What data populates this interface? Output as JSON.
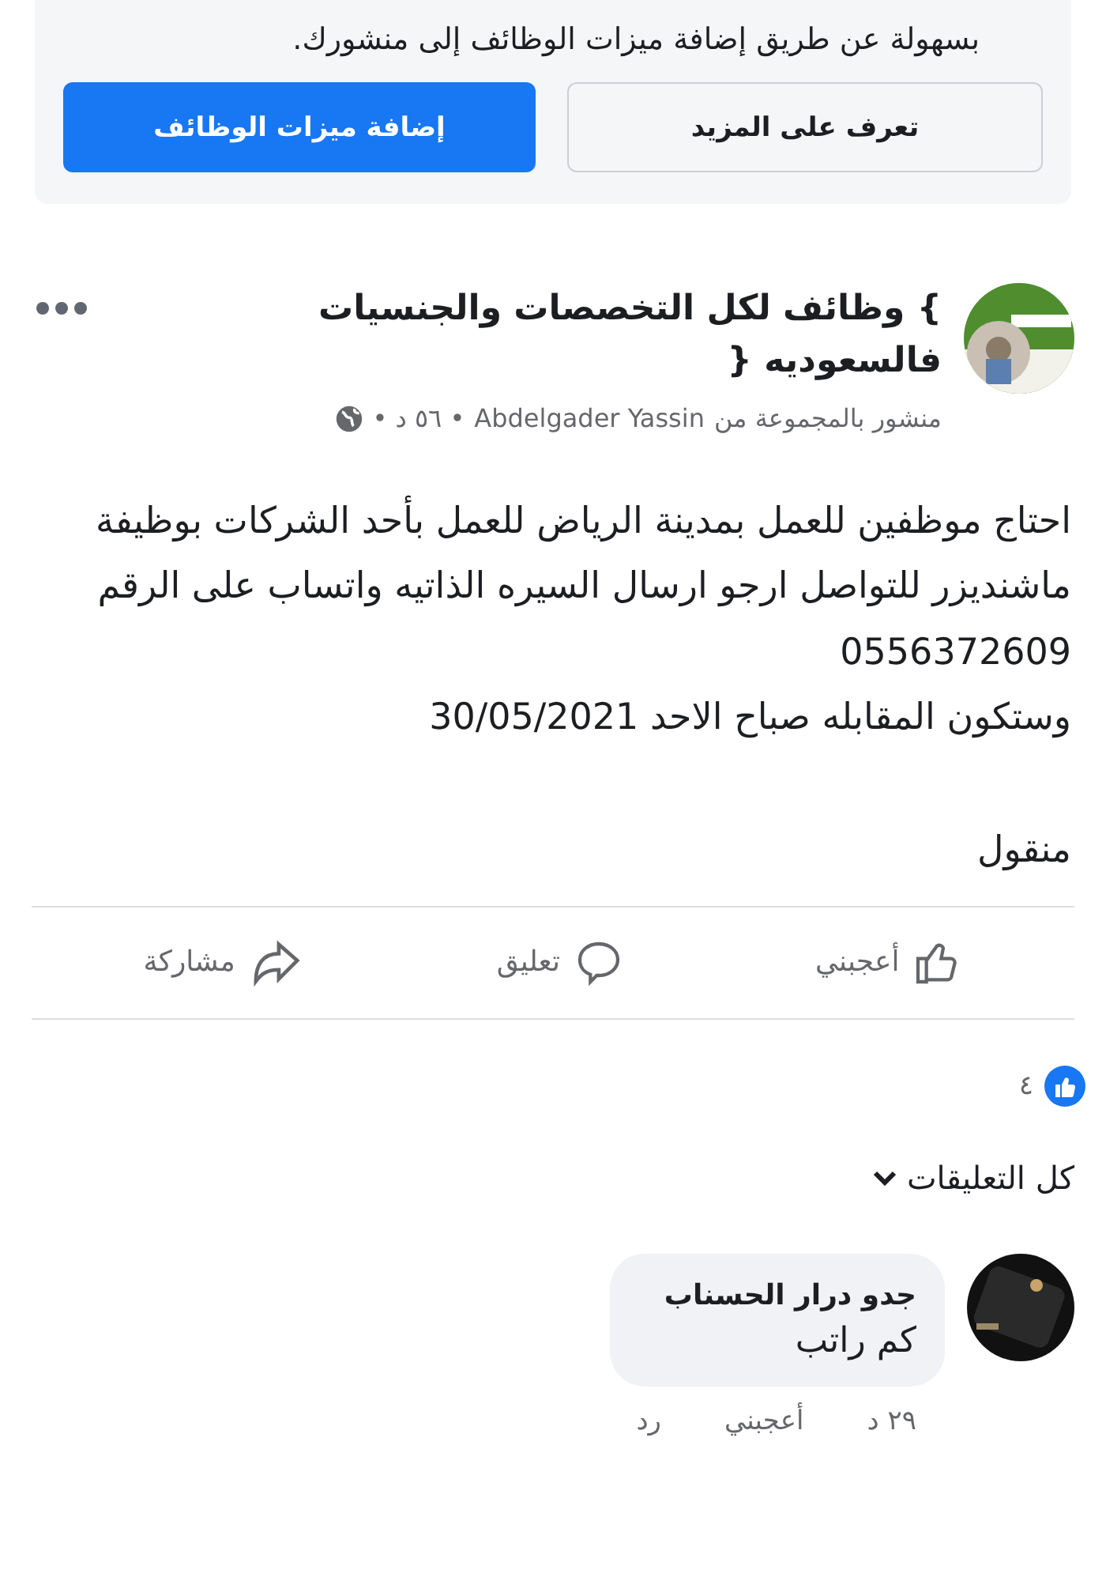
{
  "promo": {
    "text": "بسهولة عن طريق إضافة ميزات الوظائف إلى منشورك.",
    "buttons": [
      {
        "label": "تعرف على المزيد",
        "kind": "secondary"
      },
      {
        "label": "إضافة ميزات الوظائف",
        "kind": "primary"
      }
    ]
  },
  "post": {
    "group_name": "} وظائف لكل التخصصات والجنسيات فالسعوديه {",
    "posted_in": "منشور بالمجموعة من",
    "author": "Abdelgader Yassin",
    "time": "• ٥٦ د •",
    "body": [
      [
        "احتاج موظفين للعمل بمدينة الرياض للعمل بأحد الشركات بوظيفة ماشنديزر للتواصل ارجو ارسال السيره الذاتيه  واتساب على الرقم 0556372609",
        "وستكون المقابله صباح الاحد 30/05/2021"
      ],
      [
        "منقول"
      ]
    ],
    "actions": [
      {
        "label": "أعجبني",
        "kind": "like"
      },
      {
        "label": "تعليق",
        "kind": "comment"
      },
      {
        "label": "مشاركة",
        "kind": "share"
      }
    ],
    "reaction_count": "٤"
  },
  "comments_filter": "كل التعليقات",
  "comments": [
    {
      "author": "جدو درار الحسناب",
      "text": "كم راتب",
      "time": "٢٩ د",
      "like": "أعجبني",
      "reply": "رد"
    }
  ]
}
